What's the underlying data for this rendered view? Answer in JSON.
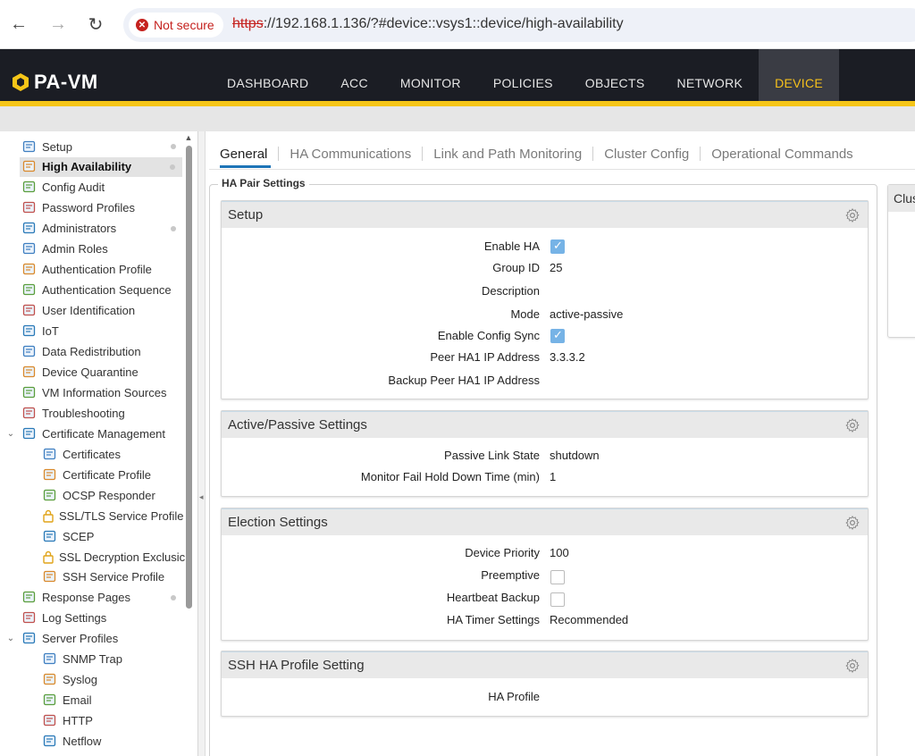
{
  "browser": {
    "security_label": "Not secure",
    "url_scheme": "https",
    "url_rest": "://192.168.1.136/?#device::vsys1::device/high-availability"
  },
  "app": {
    "logo_text": "PA-VM",
    "nav": [
      {
        "label": "DASHBOARD"
      },
      {
        "label": "ACC"
      },
      {
        "label": "MONITOR"
      },
      {
        "label": "POLICIES"
      },
      {
        "label": "OBJECTS"
      },
      {
        "label": "NETWORK"
      },
      {
        "label": "DEVICE"
      }
    ],
    "active_nav": "DEVICE",
    "accent_color": "#f5c518"
  },
  "sidebar": {
    "items": [
      {
        "label": "Setup",
        "icon": "setup-icon",
        "dot": true
      },
      {
        "label": "High Availability",
        "icon": "high-availability-icon",
        "dot": true,
        "selected": true
      },
      {
        "label": "Config Audit",
        "icon": "config-audit-icon"
      },
      {
        "label": "Password Profiles",
        "icon": "password-profiles-icon"
      },
      {
        "label": "Administrators",
        "icon": "administrators-icon",
        "dot": true
      },
      {
        "label": "Admin Roles",
        "icon": "admin-roles-icon"
      },
      {
        "label": "Authentication Profile",
        "icon": "authentication-profile-icon"
      },
      {
        "label": "Authentication Sequence",
        "icon": "authentication-sequence-icon"
      },
      {
        "label": "User Identification",
        "icon": "user-identification-icon"
      },
      {
        "label": "IoT",
        "icon": "iot-icon"
      },
      {
        "label": "Data Redistribution",
        "icon": "data-redistribution-icon"
      },
      {
        "label": "Device Quarantine",
        "icon": "device-quarantine-icon"
      },
      {
        "label": "VM Information Sources",
        "icon": "vm-information-sources-icon"
      },
      {
        "label": "Troubleshooting",
        "icon": "troubleshooting-icon"
      },
      {
        "label": "Certificate Management",
        "icon": "certificate-management-icon",
        "expanded": true
      },
      {
        "label": "Certificates",
        "icon": "certificates-icon",
        "child": true
      },
      {
        "label": "Certificate Profile",
        "icon": "certificate-profile-icon",
        "child": true
      },
      {
        "label": "OCSP Responder",
        "icon": "ocsp-responder-icon",
        "child": true
      },
      {
        "label": "SSL/TLS Service Profile",
        "icon": "lock-icon",
        "child": true
      },
      {
        "label": "SCEP",
        "icon": "scep-icon",
        "child": true
      },
      {
        "label": "SSL Decryption Exclusic",
        "icon": "lock-icon",
        "child": true
      },
      {
        "label": "SSH Service Profile",
        "icon": "ssh-service-profile-icon",
        "child": true
      },
      {
        "label": "Response Pages",
        "icon": "response-pages-icon",
        "dot": true
      },
      {
        "label": "Log Settings",
        "icon": "log-settings-icon"
      },
      {
        "label": "Server Profiles",
        "icon": "server-profiles-icon",
        "expanded": true
      },
      {
        "label": "SNMP Trap",
        "icon": "snmp-trap-icon",
        "child": true
      },
      {
        "label": "Syslog",
        "icon": "syslog-icon",
        "child": true
      },
      {
        "label": "Email",
        "icon": "email-icon",
        "child": true
      },
      {
        "label": "HTTP",
        "icon": "http-icon",
        "child": true
      },
      {
        "label": "Netflow",
        "icon": "netflow-icon",
        "child": true
      }
    ]
  },
  "tabs": [
    {
      "label": "General",
      "active": true
    },
    {
      "label": "HA Communications"
    },
    {
      "label": "Link and Path Monitoring"
    },
    {
      "label": "Cluster Config"
    },
    {
      "label": "Operational Commands"
    }
  ],
  "ha_pair": {
    "legend": "HA Pair Settings",
    "setup": {
      "title": "Setup",
      "enable_ha_label": "Enable HA",
      "enable_ha": true,
      "group_id_label": "Group ID",
      "group_id": "25",
      "description_label": "Description",
      "description": "",
      "mode_label": "Mode",
      "mode": "active-passive",
      "enable_config_sync_label": "Enable Config Sync",
      "enable_config_sync": true,
      "peer_ha1_label": "Peer HA1 IP Address",
      "peer_ha1": "3.3.3.2",
      "backup_peer_ha1_label": "Backup Peer HA1 IP Address",
      "backup_peer_ha1": ""
    },
    "active_passive": {
      "title": "Active/Passive Settings",
      "passive_link_state_label": "Passive Link State",
      "passive_link_state": "shutdown",
      "monitor_fail_label": "Monitor Fail Hold Down Time (min)",
      "monitor_fail": "1"
    },
    "election": {
      "title": "Election Settings",
      "device_priority_label": "Device Priority",
      "device_priority": "100",
      "preemptive_label": "Preemptive",
      "preemptive": false,
      "heartbeat_backup_label": "Heartbeat Backup",
      "heartbeat_backup": false,
      "ha_timer_label": "HA Timer Settings",
      "ha_timer": "Recommended"
    },
    "ssh_ha": {
      "title": "SSH HA Profile Setting",
      "ha_profile_label": "HA Profile",
      "ha_profile": ""
    }
  },
  "cluster": {
    "title_partial": "Clus"
  }
}
